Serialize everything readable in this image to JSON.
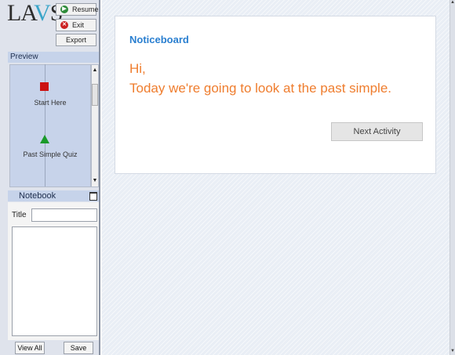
{
  "app": {
    "logo_prefix": "LA",
    "logo_v": "V",
    "logo_suffix": "S"
  },
  "toolbar": {
    "resume_label": "Resume",
    "exit_label": "Exit",
    "export_label": "Export"
  },
  "preview": {
    "header": "Preview",
    "activities": [
      {
        "label": "Start Here",
        "icon": "red-square",
        "color": "#cc1111"
      },
      {
        "label": "Past Simple Quiz",
        "icon": "green-triangle",
        "color": "#1a9a2a"
      }
    ]
  },
  "notebook": {
    "header": "Notebook",
    "title_label": "Title",
    "title_value": "",
    "body_value": "",
    "view_all_label": "View All",
    "save_label": "Save"
  },
  "main": {
    "card_title": "Noticeboard",
    "message_line1": "Hi,",
    "message_line2": "Today we're going to look at the past simple.",
    "next_button_label": "Next Activity"
  },
  "colors": {
    "accent_blue": "#2a7fd0",
    "message_orange": "#ef7d2e",
    "sidebar_header": "#c6d3ea"
  }
}
